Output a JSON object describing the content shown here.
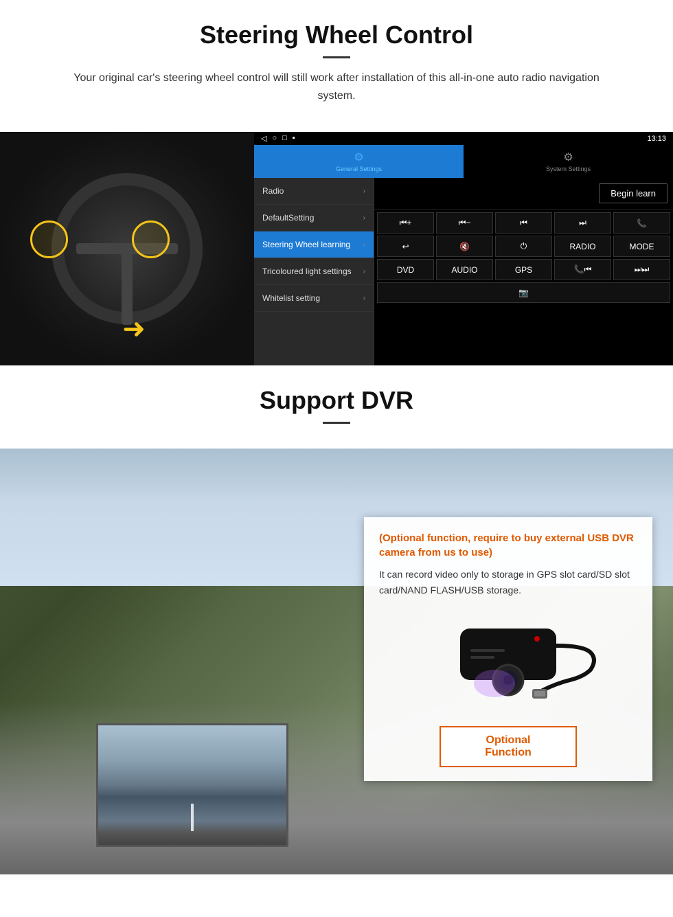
{
  "steering_section": {
    "title": "Steering Wheel Control",
    "subtitle": "Your original car's steering wheel control will still work after installation of this all-in-one auto radio navigation system.",
    "android_ui": {
      "status_bar": {
        "nav_back": "◁",
        "nav_home": "○",
        "nav_square": "□",
        "nav_menu": "▪",
        "signal": "▾",
        "wifi": "▾",
        "time": "13:13"
      },
      "tabs": [
        {
          "label": "General Settings",
          "active": true
        },
        {
          "label": "System Settings",
          "active": false
        }
      ],
      "menu_items": [
        {
          "label": "Radio",
          "active": false
        },
        {
          "label": "DefaultSetting",
          "active": false
        },
        {
          "label": "Steering Wheel learning",
          "active": true
        },
        {
          "label": "Tricoloured light settings",
          "active": false
        },
        {
          "label": "Whitelist setting",
          "active": false
        }
      ],
      "begin_learn_label": "Begin learn",
      "control_buttons": [
        [
          "⏮+",
          "⏮-",
          "⏮",
          "⏭",
          "📞"
        ],
        [
          "↩",
          "🔇",
          "⏻",
          "RADIO",
          "MODE"
        ],
        [
          "DVD",
          "AUDIO",
          "GPS",
          "📞⏮",
          "⏭⏭"
        ],
        [
          "📷"
        ]
      ]
    }
  },
  "dvr_section": {
    "title": "Support DVR",
    "optional_text": "(Optional function, require to buy external USB DVR camera from us to use)",
    "description": "It can record video only to storage in GPS slot card/SD slot card/NAND FLASH/USB storage.",
    "optional_function_label": "Optional Function"
  }
}
